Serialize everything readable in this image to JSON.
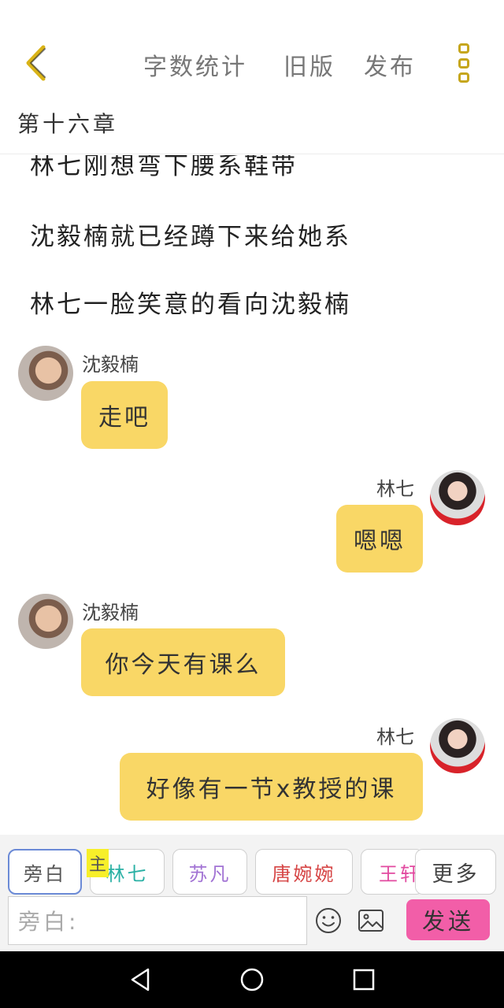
{
  "header": {
    "back_icon": "chevron-left-icon",
    "word_count": "字数统计",
    "old_version": "旧版",
    "publish": "发布",
    "more_icon": "more-vertical-icon",
    "accent_color": "#c6a61c"
  },
  "chapter": {
    "title": "第十六章"
  },
  "narration": [
    "林七刚想弯下腰系鞋带",
    "沈毅楠就已经蹲下来给她系",
    "林七一脸笑意的看向沈毅楠"
  ],
  "messages": [
    {
      "speaker": "沈毅楠",
      "text": "走吧",
      "side": "left"
    },
    {
      "speaker": "林七",
      "text": "嗯嗯",
      "side": "right"
    },
    {
      "speaker": "沈毅楠",
      "text": "你今天有课么",
      "side": "left"
    },
    {
      "speaker": "林七",
      "text": "好像有一节x教授的课",
      "side": "right"
    }
  ],
  "bubble_color": "#f9d766",
  "characters": {
    "narrator": "旁白",
    "main_badge": "主",
    "lin_qi": "林七",
    "su_fan": "苏凡",
    "tang": "唐婉婉",
    "wang": "王轩",
    "more": "更多"
  },
  "input": {
    "placeholder": "旁白:"
  },
  "send_label": "发送",
  "send_color": "#f25ea8",
  "toolbar_icons": [
    "emoji-icon",
    "image-icon"
  ],
  "navbar_icons": [
    "nav-back-icon",
    "nav-home-icon",
    "nav-recent-icon"
  ]
}
